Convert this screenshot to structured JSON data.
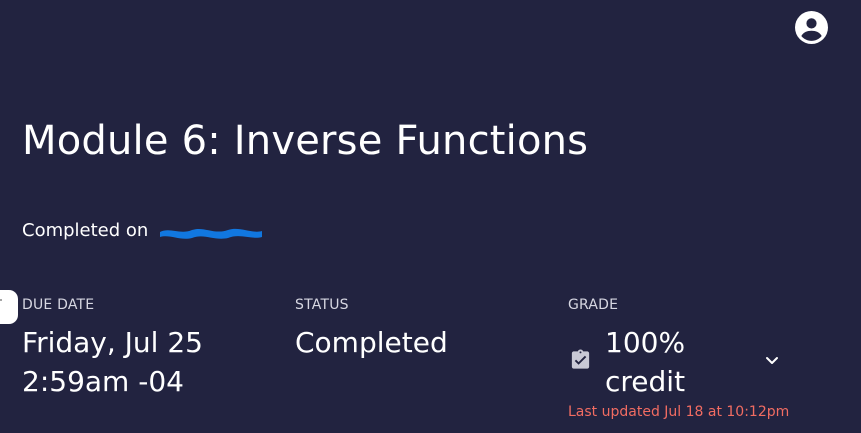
{
  "header": {
    "account_icon": "account-circle-icon"
  },
  "assignment": {
    "title": "Module 6: Inverse Functions",
    "completed_prefix": "Completed on"
  },
  "details": {
    "due_date": {
      "label": "DUE DATE",
      "line1": "Friday, Jul 25",
      "line2": "2:59am -04"
    },
    "status": {
      "label": "STATUS",
      "value": "Completed"
    },
    "grade": {
      "label": "GRADE",
      "icon": "clipboard-check-icon",
      "line1": "100%",
      "line2": "credit",
      "last_updated": "Last updated Jul 18 at 10:12pm",
      "expand_icon": "chevron-down-icon"
    }
  },
  "colors": {
    "background": "#222340",
    "text": "#ffffff",
    "label": "#d7d7e2",
    "redaction": "#1177e0",
    "updated_text": "#f16c62"
  }
}
